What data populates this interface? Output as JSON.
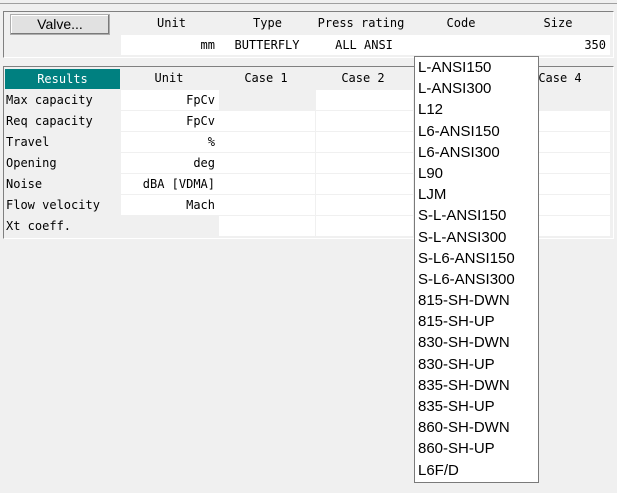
{
  "valve_table": {
    "button_label": "Valve...",
    "headers": [
      "Unit",
      "Type",
      "Press rating",
      "Code",
      "Size"
    ],
    "values": [
      "mm",
      "BUTTERFLY",
      "ALL ANSI",
      "",
      "350"
    ]
  },
  "results_table": {
    "header_label": "Results",
    "headers": [
      "Unit",
      "Case 1",
      "Case 2",
      "Case 4"
    ],
    "rows": [
      {
        "label": "Max capacity",
        "unit": "FpCv"
      },
      {
        "label": "Req capacity",
        "unit": "FpCv"
      },
      {
        "label": "Travel",
        "unit": "%"
      },
      {
        "label": "Opening",
        "unit": "deg"
      },
      {
        "label": "Noise",
        "unit": "dBA [VDMA]"
      },
      {
        "label": "Flow velocity",
        "unit": "Mach"
      },
      {
        "label": "Xt coeff.",
        "unit": ""
      }
    ]
  },
  "code_dropdown": {
    "options": [
      "L-ANSI150",
      "L-ANSI300",
      "L12",
      "L6-ANSI150",
      "L6-ANSI300",
      "L90",
      "LJM",
      "S-L-ANSI150",
      "S-L-ANSI300",
      "S-L6-ANSI150",
      "S-L6-ANSI300",
      "815-SH-DWN",
      "815-SH-UP",
      "830-SH-DWN",
      "830-SH-UP",
      "835-SH-DWN",
      "835-SH-UP",
      "860-SH-DWN",
      "860-SH-UP",
      "L6F/D"
    ]
  }
}
